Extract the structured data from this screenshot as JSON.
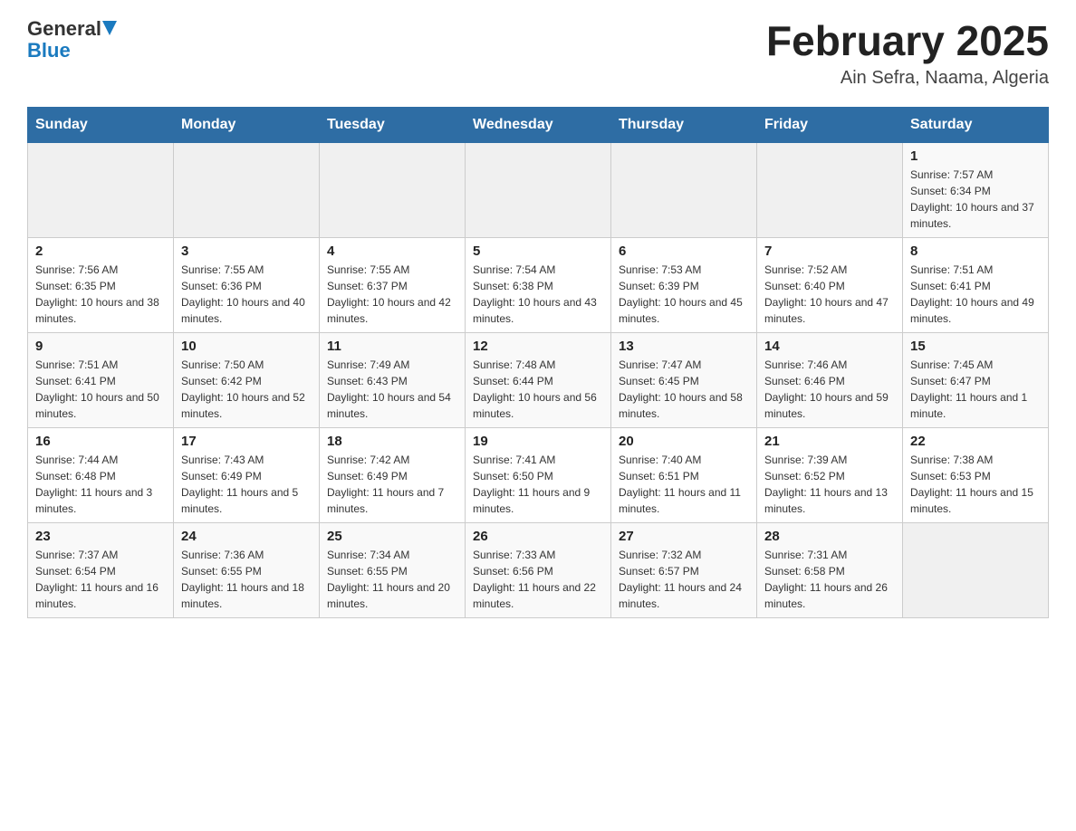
{
  "header": {
    "logo_general": "General",
    "logo_blue": "Blue",
    "title": "February 2025",
    "subtitle": "Ain Sefra, Naama, Algeria"
  },
  "weekdays": [
    "Sunday",
    "Monday",
    "Tuesday",
    "Wednesday",
    "Thursday",
    "Friday",
    "Saturday"
  ],
  "weeks": [
    [
      {
        "day": "",
        "sunrise": "",
        "sunset": "",
        "daylight": ""
      },
      {
        "day": "",
        "sunrise": "",
        "sunset": "",
        "daylight": ""
      },
      {
        "day": "",
        "sunrise": "",
        "sunset": "",
        "daylight": ""
      },
      {
        "day": "",
        "sunrise": "",
        "sunset": "",
        "daylight": ""
      },
      {
        "day": "",
        "sunrise": "",
        "sunset": "",
        "daylight": ""
      },
      {
        "day": "",
        "sunrise": "",
        "sunset": "",
        "daylight": ""
      },
      {
        "day": "1",
        "sunrise": "Sunrise: 7:57 AM",
        "sunset": "Sunset: 6:34 PM",
        "daylight": "Daylight: 10 hours and 37 minutes."
      }
    ],
    [
      {
        "day": "2",
        "sunrise": "Sunrise: 7:56 AM",
        "sunset": "Sunset: 6:35 PM",
        "daylight": "Daylight: 10 hours and 38 minutes."
      },
      {
        "day": "3",
        "sunrise": "Sunrise: 7:55 AM",
        "sunset": "Sunset: 6:36 PM",
        "daylight": "Daylight: 10 hours and 40 minutes."
      },
      {
        "day": "4",
        "sunrise": "Sunrise: 7:55 AM",
        "sunset": "Sunset: 6:37 PM",
        "daylight": "Daylight: 10 hours and 42 minutes."
      },
      {
        "day": "5",
        "sunrise": "Sunrise: 7:54 AM",
        "sunset": "Sunset: 6:38 PM",
        "daylight": "Daylight: 10 hours and 43 minutes."
      },
      {
        "day": "6",
        "sunrise": "Sunrise: 7:53 AM",
        "sunset": "Sunset: 6:39 PM",
        "daylight": "Daylight: 10 hours and 45 minutes."
      },
      {
        "day": "7",
        "sunrise": "Sunrise: 7:52 AM",
        "sunset": "Sunset: 6:40 PM",
        "daylight": "Daylight: 10 hours and 47 minutes."
      },
      {
        "day": "8",
        "sunrise": "Sunrise: 7:51 AM",
        "sunset": "Sunset: 6:41 PM",
        "daylight": "Daylight: 10 hours and 49 minutes."
      }
    ],
    [
      {
        "day": "9",
        "sunrise": "Sunrise: 7:51 AM",
        "sunset": "Sunset: 6:41 PM",
        "daylight": "Daylight: 10 hours and 50 minutes."
      },
      {
        "day": "10",
        "sunrise": "Sunrise: 7:50 AM",
        "sunset": "Sunset: 6:42 PM",
        "daylight": "Daylight: 10 hours and 52 minutes."
      },
      {
        "day": "11",
        "sunrise": "Sunrise: 7:49 AM",
        "sunset": "Sunset: 6:43 PM",
        "daylight": "Daylight: 10 hours and 54 minutes."
      },
      {
        "day": "12",
        "sunrise": "Sunrise: 7:48 AM",
        "sunset": "Sunset: 6:44 PM",
        "daylight": "Daylight: 10 hours and 56 minutes."
      },
      {
        "day": "13",
        "sunrise": "Sunrise: 7:47 AM",
        "sunset": "Sunset: 6:45 PM",
        "daylight": "Daylight: 10 hours and 58 minutes."
      },
      {
        "day": "14",
        "sunrise": "Sunrise: 7:46 AM",
        "sunset": "Sunset: 6:46 PM",
        "daylight": "Daylight: 10 hours and 59 minutes."
      },
      {
        "day": "15",
        "sunrise": "Sunrise: 7:45 AM",
        "sunset": "Sunset: 6:47 PM",
        "daylight": "Daylight: 11 hours and 1 minute."
      }
    ],
    [
      {
        "day": "16",
        "sunrise": "Sunrise: 7:44 AM",
        "sunset": "Sunset: 6:48 PM",
        "daylight": "Daylight: 11 hours and 3 minutes."
      },
      {
        "day": "17",
        "sunrise": "Sunrise: 7:43 AM",
        "sunset": "Sunset: 6:49 PM",
        "daylight": "Daylight: 11 hours and 5 minutes."
      },
      {
        "day": "18",
        "sunrise": "Sunrise: 7:42 AM",
        "sunset": "Sunset: 6:49 PM",
        "daylight": "Daylight: 11 hours and 7 minutes."
      },
      {
        "day": "19",
        "sunrise": "Sunrise: 7:41 AM",
        "sunset": "Sunset: 6:50 PM",
        "daylight": "Daylight: 11 hours and 9 minutes."
      },
      {
        "day": "20",
        "sunrise": "Sunrise: 7:40 AM",
        "sunset": "Sunset: 6:51 PM",
        "daylight": "Daylight: 11 hours and 11 minutes."
      },
      {
        "day": "21",
        "sunrise": "Sunrise: 7:39 AM",
        "sunset": "Sunset: 6:52 PM",
        "daylight": "Daylight: 11 hours and 13 minutes."
      },
      {
        "day": "22",
        "sunrise": "Sunrise: 7:38 AM",
        "sunset": "Sunset: 6:53 PM",
        "daylight": "Daylight: 11 hours and 15 minutes."
      }
    ],
    [
      {
        "day": "23",
        "sunrise": "Sunrise: 7:37 AM",
        "sunset": "Sunset: 6:54 PM",
        "daylight": "Daylight: 11 hours and 16 minutes."
      },
      {
        "day": "24",
        "sunrise": "Sunrise: 7:36 AM",
        "sunset": "Sunset: 6:55 PM",
        "daylight": "Daylight: 11 hours and 18 minutes."
      },
      {
        "day": "25",
        "sunrise": "Sunrise: 7:34 AM",
        "sunset": "Sunset: 6:55 PM",
        "daylight": "Daylight: 11 hours and 20 minutes."
      },
      {
        "day": "26",
        "sunrise": "Sunrise: 7:33 AM",
        "sunset": "Sunset: 6:56 PM",
        "daylight": "Daylight: 11 hours and 22 minutes."
      },
      {
        "day": "27",
        "sunrise": "Sunrise: 7:32 AM",
        "sunset": "Sunset: 6:57 PM",
        "daylight": "Daylight: 11 hours and 24 minutes."
      },
      {
        "day": "28",
        "sunrise": "Sunrise: 7:31 AM",
        "sunset": "Sunset: 6:58 PM",
        "daylight": "Daylight: 11 hours and 26 minutes."
      },
      {
        "day": "",
        "sunrise": "",
        "sunset": "",
        "daylight": ""
      }
    ]
  ]
}
